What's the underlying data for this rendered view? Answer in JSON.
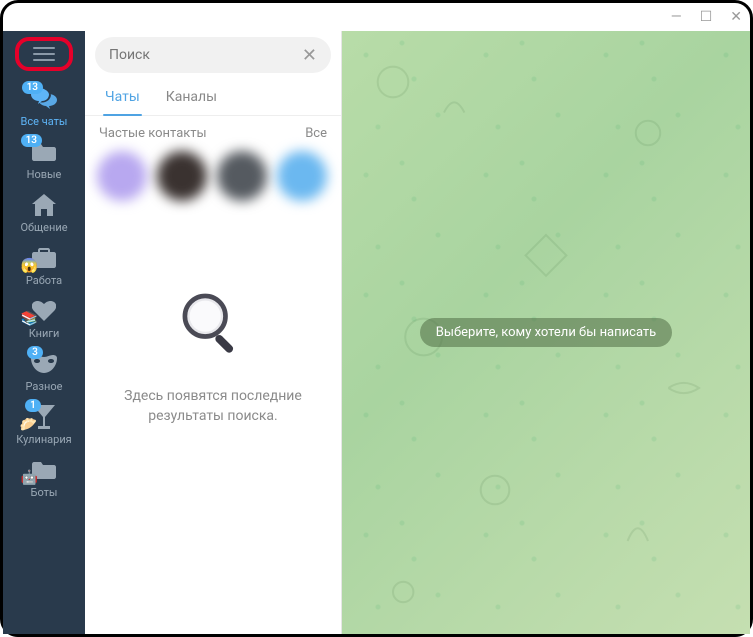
{
  "window": {
    "minimize": "—",
    "maximize": "☐",
    "close": "✕"
  },
  "search": {
    "placeholder": "Поиск",
    "clear": "✕"
  },
  "tabs": {
    "chats": "Чаты",
    "channels": "Каналы"
  },
  "contacts": {
    "frequent": "Частые контакты",
    "all": "Все"
  },
  "empty_search": "Здесь появятся последние результаты поиска.",
  "content_hint": "Выберите, кому хотели бы написать",
  "folders": [
    {
      "label": "Все чаты",
      "badge": "13",
      "icon": "chats",
      "active": true
    },
    {
      "label": "Новые",
      "badge": "13",
      "icon": "folder"
    },
    {
      "label": "Общение",
      "icon": "home"
    },
    {
      "label": "Работа",
      "icon": "briefcase",
      "emoji": "😱"
    },
    {
      "label": "Книги",
      "icon": "heart",
      "emoji": "📚"
    },
    {
      "label": "Разное",
      "badge": "3",
      "icon": "mask"
    },
    {
      "label": "Кулинария",
      "badge": "1",
      "icon": "cocktail",
      "emoji": "🥟"
    },
    {
      "label": "Боты",
      "icon": "folder",
      "emoji": "🤖"
    }
  ],
  "avatar_colors": [
    "#b8a8f0",
    "#3a3230",
    "#555a60",
    "#6bb8f0"
  ]
}
